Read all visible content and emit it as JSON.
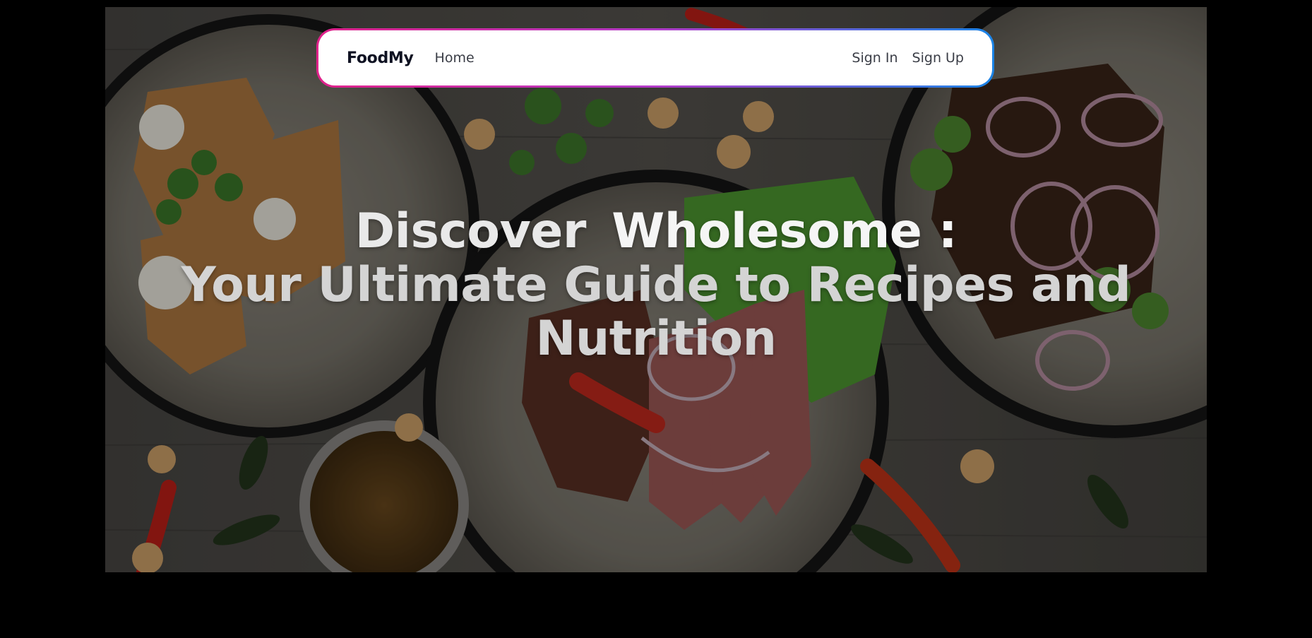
{
  "navbar": {
    "brand": "FoodMy",
    "links": [
      {
        "label": "Home"
      }
    ],
    "auth": {
      "sign_in": "Sign In",
      "sign_up": "Sign Up"
    },
    "border_gradient": [
      "#e0218a",
      "#b33bc9",
      "#1b84e6"
    ]
  },
  "hero": {
    "headline_part1": "Discover",
    "headline_part2": "Wholesome",
    "headline_colon": ":",
    "headline_line2": "Your Ultimate Guide to Recipes and Nutrition",
    "background": "food-plates-photo"
  }
}
